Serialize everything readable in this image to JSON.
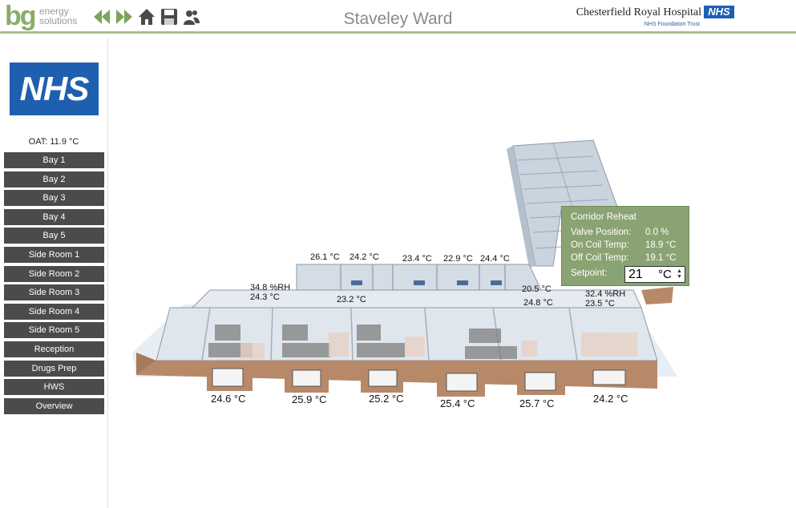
{
  "header": {
    "brand_mark": "bg",
    "brand_line1": "energy",
    "brand_line2": "solutions",
    "title": "Staveley Ward",
    "hospital_name": "Chesterfield Royal Hospital",
    "hospital_badge": "NHS",
    "trust": "NHS Foundation Trust",
    "nav_icons": [
      "back-arrow-icon",
      "forward-arrow-icon",
      "home-icon",
      "save-icon",
      "users-icon"
    ]
  },
  "sidebar": {
    "logo_text": "NHS",
    "oat": "OAT: 11.9 °C",
    "items": [
      "Bay 1",
      "Bay 2",
      "Bay 3",
      "Bay 4",
      "Bay 5",
      "Side Room 1",
      "Side Room 2",
      "Side Room 3",
      "Side Room 4",
      "Side Room 5",
      "Reception",
      "Drugs Prep",
      "HWS",
      "Overview"
    ]
  },
  "floor": {
    "rear_rooms": [
      "26.1 °C",
      "24.2 °C",
      "23.4 °C",
      "22.9 °C",
      "24.4 °C"
    ],
    "left_humidity": "34.8 %RH",
    "left_temp": "24.3 °C",
    "corridor_temp": "23.2 °C",
    "mid_temp_a": "20.5 °C",
    "mid_temp_b": "24.8 °C",
    "right_humidity": "32.4 %RH",
    "right_temp": "23.5 °C",
    "bays": [
      "24.6 °C",
      "25.9 °C",
      "25.2 °C",
      "25.4 °C",
      "25.7 °C",
      "24.2 °C"
    ]
  },
  "popup": {
    "title": "Corridor Reheat",
    "valve_label": "Valve Position:",
    "valve_value": "0.0 %",
    "on_label": "On Coil Temp:",
    "on_value": "18.9 °C",
    "off_label": "Off Coil Temp:",
    "off_value": "19.1 °C",
    "setpoint_label": "Setpoint:",
    "setpoint_value": "21",
    "setpoint_unit": "°C"
  }
}
